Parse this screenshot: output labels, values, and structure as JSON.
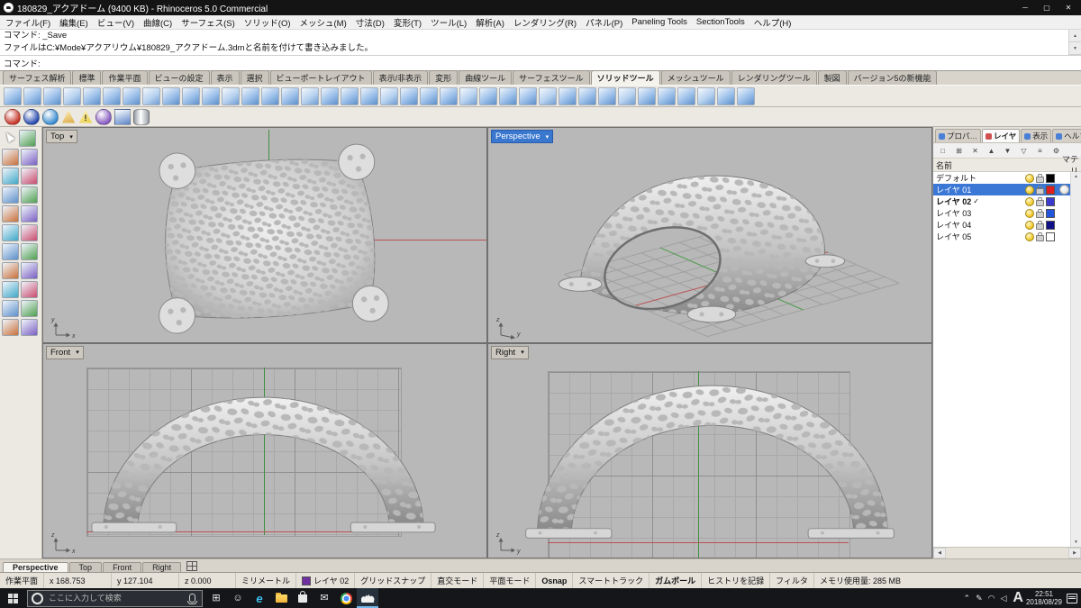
{
  "window": {
    "title": "180829_アクアドーム (9400 KB) - Rhinoceros 5.0 Commercial"
  },
  "icons": {
    "minimize": "─",
    "maximize": "▢",
    "close": "✕",
    "caret_down": "▾",
    "scroll_up": "▲",
    "scroll_down": "▼",
    "scroll_left": "◀",
    "scroll_right": "▶",
    "check": "✓"
  },
  "menu": {
    "items": [
      "ファイル(F)",
      "編集(E)",
      "ビュー(V)",
      "曲線(C)",
      "サーフェス(S)",
      "ソリッド(O)",
      "メッシュ(M)",
      "寸法(D)",
      "変形(T)",
      "ツール(L)",
      "解析(A)",
      "レンダリング(R)",
      "パネル(P)",
      "Paneling Tools",
      "SectionTools",
      "ヘルプ(H)"
    ]
  },
  "command": {
    "history": [
      "コマンド: _Save",
      "ファイルはC:¥Mode¥アクアリウム¥180829_アクアドーム.3dmと名前を付けて書き込みました。"
    ],
    "prompt": "コマンド:"
  },
  "toolbar_tabs": {
    "items": [
      "サーフェス解析",
      "標準",
      "作業平面",
      "ビューの設定",
      "表示",
      "選択",
      "ビューポートレイアウト",
      "表示/非表示",
      "変形",
      "曲線ツール",
      "サーフェスツール",
      "ソリッドツール",
      "メッシュツール",
      "レンダリングツール",
      "製図",
      "バージョン5の新機能"
    ],
    "active": "ソリッドツール"
  },
  "toolbars": {
    "main_count": 38,
    "left_count": 22,
    "left_palette": [
      "#5d8fc9",
      "#4f9e4f",
      "#c9703a",
      "#7a5fc2",
      "#3fa8c8",
      "#c94a6e"
    ],
    "sub": [
      {
        "type": "sphere",
        "color": "#c93a2e"
      },
      {
        "type": "sphere",
        "color": "#2d4fb0"
      },
      {
        "type": "sphere",
        "color": "#3f8fd2"
      },
      {
        "type": "cone",
        "color": "#d8a43a"
      },
      {
        "type": "warning",
        "color": "#e8cc3a"
      },
      {
        "type": "sphere",
        "color": "#8a5fc2"
      },
      {
        "type": "cube",
        "color": "#5a84c8"
      },
      {
        "type": "cylinder",
        "color": "#9aa0a8"
      }
    ]
  },
  "viewports": {
    "active": "Perspective",
    "top": {
      "label": "Top",
      "axes": [
        "y",
        "x"
      ]
    },
    "perspective": {
      "label": "Perspective",
      "axes": [
        "z",
        "y"
      ]
    },
    "front": {
      "label": "Front",
      "axes": [
        "z",
        "x"
      ]
    },
    "right": {
      "label": "Right",
      "axes": [
        "z",
        "y"
      ]
    }
  },
  "layer_panel": {
    "tabs": [
      {
        "label": "プロパ…",
        "color": "#4a7fd6"
      },
      {
        "label": "レイヤ",
        "color": "#d05050"
      },
      {
        "label": "表示",
        "color": "#4a7fd6"
      },
      {
        "label": "ヘルプ",
        "color": "#4a7fd6"
      }
    ],
    "active_tab": "レイヤ",
    "toolbar_icons": [
      {
        "name": "new-layer",
        "glyph": "□"
      },
      {
        "name": "new-sublayer",
        "glyph": "⊞"
      },
      {
        "name": "delete-layer",
        "glyph": "✕"
      },
      {
        "name": "move-up",
        "glyph": "▲"
      },
      {
        "name": "move-down",
        "glyph": "▼"
      },
      {
        "name": "filter",
        "glyph": "▽"
      },
      {
        "name": "layer-tools",
        "glyph": "≡"
      },
      {
        "name": "settings",
        "glyph": "⚙"
      }
    ],
    "columns": {
      "name": "名前",
      "material": "マテリ"
    },
    "layers": [
      {
        "name": "デフォルト",
        "color": "#000000",
        "current": false,
        "selected": false
      },
      {
        "name": "レイヤ 01",
        "color": "#e02020",
        "current": false,
        "selected": true
      },
      {
        "name": "レイヤ 02",
        "color": "#3b3bd0",
        "current": true,
        "selected": false
      },
      {
        "name": "レイヤ 03",
        "color": "#2255dd",
        "current": false,
        "selected": false
      },
      {
        "name": "レイヤ 04",
        "color": "#101088",
        "current": false,
        "selected": false
      },
      {
        "name": "レイヤ 05",
        "color": "#ffffff",
        "current": false,
        "selected": false
      }
    ]
  },
  "viewport_tabs": {
    "items": [
      "Perspective",
      "Top",
      "Front",
      "Right"
    ],
    "active": "Perspective"
  },
  "statusbar": {
    "cplane": "作業平面",
    "x": "x 168.753",
    "y": "y 127.104",
    "z": "z 0.000",
    "units": "ミリメートル",
    "layer": "レイヤ 02",
    "layer_color": "#7030a0",
    "toggles": [
      {
        "label": "グリッドスナップ",
        "active": false
      },
      {
        "label": "直交モード",
        "active": false
      },
      {
        "label": "平面モード",
        "active": false
      },
      {
        "label": "Osnap",
        "active": true
      },
      {
        "label": "スマートトラック",
        "active": false
      },
      {
        "label": "ガムボール",
        "active": true
      },
      {
        "label": "ヒストリを記録",
        "active": false
      },
      {
        "label": "フィルタ",
        "active": false
      }
    ],
    "memory": "メモリ使用量: 285 MB"
  },
  "taskbar": {
    "search_placeholder": "ここに入力して検索",
    "apps": [
      {
        "name": "task-view-button",
        "icon": "task-view",
        "glyph": "⊞"
      },
      {
        "name": "people-button",
        "icon": "people",
        "glyph": "☺"
      },
      {
        "name": "edge-app-button",
        "icon": "edge",
        "glyph": "e"
      },
      {
        "name": "file-explorer-button",
        "icon": "folder",
        "glyph": ""
      },
      {
        "name": "store-app-button",
        "icon": "store",
        "glyph": ""
      },
      {
        "name": "mail-app-button",
        "icon": "mail",
        "glyph": "✉"
      },
      {
        "name": "chrome-app-button",
        "icon": "chrome",
        "glyph": ""
      },
      {
        "name": "rhino-app-button",
        "icon": "rhino",
        "glyph": "",
        "active": true
      }
    ],
    "tray": [
      {
        "name": "tray-expand-icon",
        "glyph": "⌃"
      },
      {
        "name": "pen-icon",
        "glyph": "✎"
      },
      {
        "name": "network-icon",
        "glyph": "◠"
      },
      {
        "name": "volume-icon",
        "glyph": "◁"
      }
    ],
    "ime": "A",
    "time": "22:51",
    "date": "2018/08/29"
  }
}
